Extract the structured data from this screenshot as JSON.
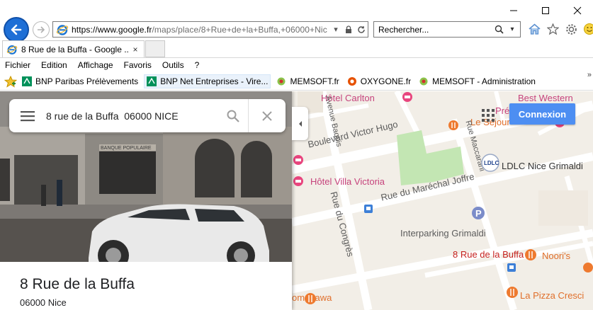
{
  "browser": {
    "address": {
      "scheme": "https://www.",
      "domain": "google.fr",
      "path": "/maps/place/8+Rue+de+la+Buffa,+06000+Nic"
    },
    "search_placeholder": "Rechercher...",
    "tab": {
      "title": "8 Rue de la Buffa - Google ...",
      "close": "×"
    },
    "menu": [
      "Fichier",
      "Edition",
      "Affichage",
      "Favoris",
      "Outils",
      "?"
    ],
    "favorites": [
      "BNP Paribas Prélèvements",
      "BNP Net Entreprises - Vire...",
      "MEMSOFT.fr",
      "OXYGONE.fr",
      "MEMSOFT - Administration"
    ],
    "favbar_more": "»"
  },
  "maps": {
    "query": "8 rue de la Buffa  06000 NICE",
    "place_title": "8 Rue de la Buffa",
    "place_subtitle": "06000 Nice",
    "signin_label": "Connexion",
    "pin_label": "8 Rue de la Buffa",
    "photo_sign": "BANQUE POPULAIRE",
    "labels": {
      "hotel_carlton": "Hôtel Carlton",
      "best_western": "Best Western",
      "le_sejour": "Le Séjour",
      "boulevard_hugo": "Boulevard Victor Hugo",
      "villa_victoria": "Hôtel Villa Victoria",
      "rue_marechal": "Rue du Maréchal Joffre",
      "rue_congres": "Rue du Congrès",
      "rue_baquis": "Avenue Baquis",
      "rue_maccarani": "Rue Maccarani",
      "ldlc": "LDLC Nice Grimaldi",
      "interparking": "Interparking Grimaldi",
      "noori": "Noori's",
      "pizza": "La Pizza Cresci",
      "omogawa": "omogawa",
      "pre": "Pré",
      "ldlc_logo": "LDLC"
    }
  }
}
